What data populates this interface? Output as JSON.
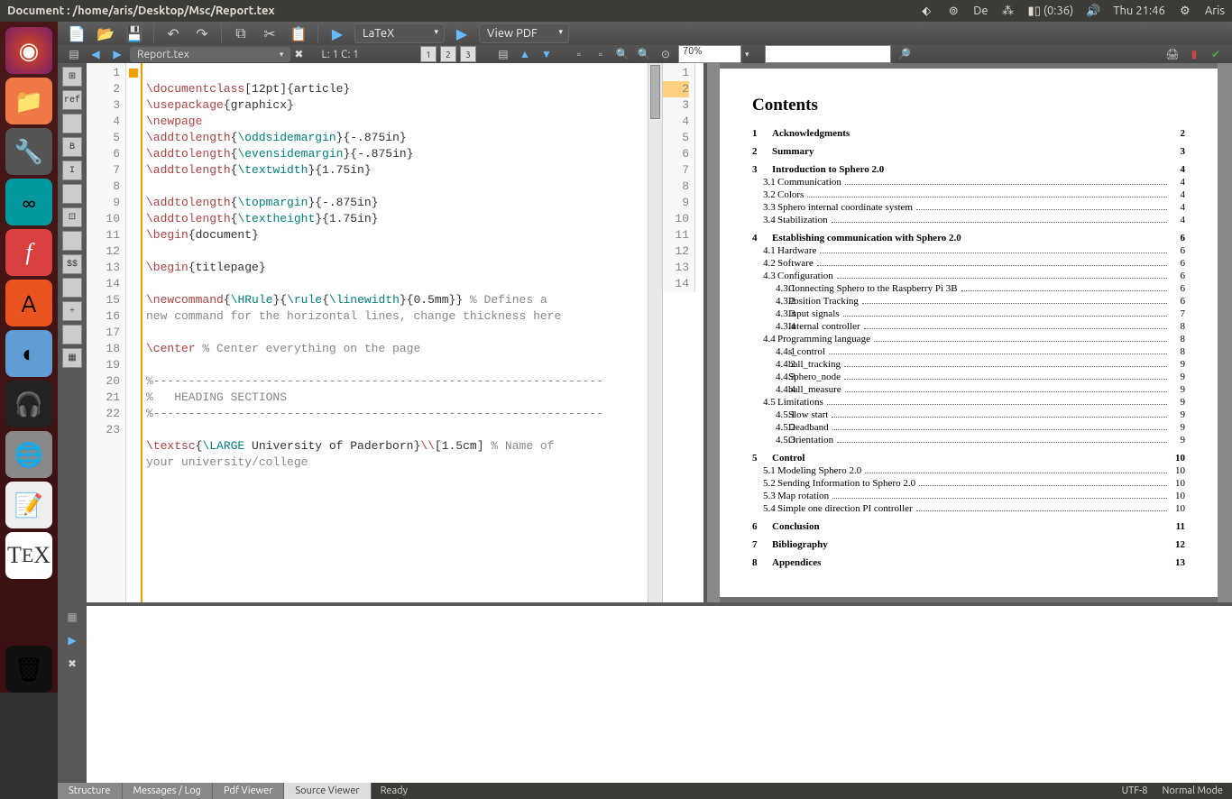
{
  "menubar": {
    "title": "Document : /home/aris/Desktop/Msc/Report.tex",
    "lang": "De",
    "battery": "(0:36)",
    "clock": "Thu 21:46",
    "user": "Aris"
  },
  "toolbar": {
    "latex_dropdown": "LaTeX",
    "view_dropdown": "View PDF"
  },
  "subtoolbar": {
    "tab_name": "Report.tex",
    "position": "L: 1 C: 1",
    "zoom": "70%"
  },
  "gutter_lines": [
    "1",
    "2",
    "3",
    "4",
    "5",
    "6",
    "7",
    "8",
    "9",
    "10",
    "11",
    "12",
    "13",
    "14",
    "15",
    "",
    "16",
    "17",
    "18",
    "19",
    "20",
    "21",
    "22",
    "23"
  ],
  "mini_gutter": [
    "1",
    "2",
    "3",
    "4",
    "5",
    "6",
    "7",
    "8",
    "9",
    "10",
    "11",
    "12",
    "13",
    "14"
  ],
  "code_lines": [
    {
      "raw": ""
    },
    {
      "parts": [
        {
          "t": "\\documentclass",
          "c": "kw"
        },
        {
          "t": "[12pt]{article}",
          "c": ""
        }
      ]
    },
    {
      "parts": [
        {
          "t": "\\usepackage",
          "c": "kw"
        },
        {
          "t": "{graphicx}",
          "c": ""
        }
      ]
    },
    {
      "parts": [
        {
          "t": "\\newpage",
          "c": "kw"
        }
      ]
    },
    {
      "parts": [
        {
          "t": "\\addtolength",
          "c": "kw"
        },
        {
          "t": "{",
          "c": ""
        },
        {
          "t": "\\oddsidemargin",
          "c": "cmd"
        },
        {
          "t": "}{-.875in}",
          "c": ""
        }
      ]
    },
    {
      "parts": [
        {
          "t": "\\addtolength",
          "c": "kw"
        },
        {
          "t": "{",
          "c": ""
        },
        {
          "t": "\\evensidemargin",
          "c": "cmd"
        },
        {
          "t": "}{-.875in}",
          "c": ""
        }
      ]
    },
    {
      "parts": [
        {
          "t": "\\addtolength",
          "c": "kw"
        },
        {
          "t": "{",
          "c": ""
        },
        {
          "t": "\\textwidth",
          "c": "cmd"
        },
        {
          "t": "}{1.75in}",
          "c": ""
        }
      ]
    },
    {
      "raw": ""
    },
    {
      "parts": [
        {
          "t": "\\addtolength",
          "c": "kw"
        },
        {
          "t": "{",
          "c": ""
        },
        {
          "t": "\\topmargin",
          "c": "cmd"
        },
        {
          "t": "}{-.875in}",
          "c": ""
        }
      ]
    },
    {
      "parts": [
        {
          "t": "\\addtolength",
          "c": "kw"
        },
        {
          "t": "{",
          "c": ""
        },
        {
          "t": "\\textheight",
          "c": "cmd"
        },
        {
          "t": "}{1.75in}",
          "c": ""
        }
      ]
    },
    {
      "parts": [
        {
          "t": "\\begin",
          "c": "kw"
        },
        {
          "t": "{document}",
          "c": ""
        }
      ]
    },
    {
      "raw": ""
    },
    {
      "parts": [
        {
          "t": "\\begin",
          "c": "kw"
        },
        {
          "t": "{titlepage}",
          "c": ""
        }
      ]
    },
    {
      "raw": ""
    },
    {
      "parts": [
        {
          "t": "\\newcommand",
          "c": "kw"
        },
        {
          "t": "{",
          "c": ""
        },
        {
          "t": "\\HRule",
          "c": "cmd"
        },
        {
          "t": "}{",
          "c": ""
        },
        {
          "t": "\\rule",
          "c": "cmd"
        },
        {
          "t": "{",
          "c": ""
        },
        {
          "t": "\\linewidth",
          "c": "cmd"
        },
        {
          "t": "}{0.5mm}} ",
          "c": ""
        },
        {
          "t": "% Defines a",
          "c": "comm"
        }
      ]
    },
    {
      "parts": [
        {
          "t": "new command for the horizontal lines, change thickness here",
          "c": "comm"
        }
      ]
    },
    {
      "raw": ""
    },
    {
      "parts": [
        {
          "t": "\\center",
          "c": "kw"
        },
        {
          "t": " ",
          "c": ""
        },
        {
          "t": "% Center everything on the page",
          "c": "comm"
        }
      ]
    },
    {
      "raw": ""
    },
    {
      "parts": [
        {
          "t": "%----------------------------------------------------------------",
          "c": "comm"
        }
      ]
    },
    {
      "parts": [
        {
          "t": "%   HEADING SECTIONS",
          "c": "comm"
        }
      ]
    },
    {
      "parts": [
        {
          "t": "%----------------------------------------------------------------",
          "c": "comm"
        }
      ]
    },
    {
      "raw": ""
    },
    {
      "parts": [
        {
          "t": "\\textsc",
          "c": "kw"
        },
        {
          "t": "{",
          "c": ""
        },
        {
          "t": "\\LARGE",
          "c": "cmd"
        },
        {
          "t": " University of Paderborn}",
          "c": ""
        },
        {
          "t": "\\\\",
          "c": "kw"
        },
        {
          "t": "[1.5cm] ",
          "c": ""
        },
        {
          "t": "% Name of",
          "c": "comm"
        }
      ]
    },
    {
      "parts": [
        {
          "t": "your university/college",
          "c": "comm"
        }
      ]
    }
  ],
  "palette": [
    "⊞",
    "ref",
    "",
    "B",
    "I",
    "",
    "⊡",
    "",
    "$$",
    "",
    "÷",
    "",
    "▦"
  ],
  "pdf": {
    "title": "Contents",
    "toc": [
      {
        "lvl": 0,
        "n": "1",
        "t": "Acknowledgments",
        "p": "2"
      },
      {
        "lvl": 0,
        "n": "2",
        "t": "Summary",
        "p": "3"
      },
      {
        "lvl": 0,
        "n": "3",
        "t": "Introduction to Sphero 2.0",
        "p": "4"
      },
      {
        "lvl": 1,
        "n": "3.1",
        "t": "Communication",
        "p": "4"
      },
      {
        "lvl": 1,
        "n": "3.2",
        "t": "Colors",
        "p": "4"
      },
      {
        "lvl": 1,
        "n": "3.3",
        "t": "Sphero internal coordinate system",
        "p": "4"
      },
      {
        "lvl": 1,
        "n": "3.4",
        "t": "Stabilization",
        "p": "4"
      },
      {
        "lvl": 0,
        "n": "4",
        "t": "Establishing communication with Sphero 2.0",
        "p": "6"
      },
      {
        "lvl": 1,
        "n": "4.1",
        "t": "Hardware",
        "p": "6"
      },
      {
        "lvl": 1,
        "n": "4.2",
        "t": "Software",
        "p": "6"
      },
      {
        "lvl": 1,
        "n": "4.3",
        "t": "Configuration",
        "p": "6"
      },
      {
        "lvl": 2,
        "n": "4.3.1",
        "t": "Connecting Sphero to the Raspberry Pi 3B",
        "p": "6"
      },
      {
        "lvl": 2,
        "n": "4.3.2",
        "t": "Position Tracking",
        "p": "6"
      },
      {
        "lvl": 2,
        "n": "4.3.3",
        "t": "Input signals",
        "p": "7"
      },
      {
        "lvl": 2,
        "n": "4.3.4",
        "t": "Internal controller",
        "p": "8"
      },
      {
        "lvl": 1,
        "n": "4.4",
        "t": "Programming language",
        "p": "8"
      },
      {
        "lvl": 2,
        "n": "4.4.1",
        "t": "s_control",
        "p": "8"
      },
      {
        "lvl": 2,
        "n": "4.4.2",
        "t": "ball_tracking",
        "p": "9"
      },
      {
        "lvl": 2,
        "n": "4.4.3",
        "t": "Sphero_node",
        "p": "9"
      },
      {
        "lvl": 2,
        "n": "4.4.4",
        "t": "ball_measure",
        "p": "9"
      },
      {
        "lvl": 1,
        "n": "4.5",
        "t": "Limitations",
        "p": "9"
      },
      {
        "lvl": 2,
        "n": "4.5.1",
        "t": "Slow start",
        "p": "9"
      },
      {
        "lvl": 2,
        "n": "4.5.2",
        "t": "Deadband",
        "p": "9"
      },
      {
        "lvl": 2,
        "n": "4.5.3",
        "t": "Orientation",
        "p": "9"
      },
      {
        "lvl": 0,
        "n": "5",
        "t": "Control",
        "p": "10"
      },
      {
        "lvl": 1,
        "n": "5.1",
        "t": "Modeling Sphero 2.0",
        "p": "10"
      },
      {
        "lvl": 1,
        "n": "5.2",
        "t": "Sending Information to Sphero 2.0",
        "p": "10"
      },
      {
        "lvl": 1,
        "n": "5.3",
        "t": "Map rotation",
        "p": "10"
      },
      {
        "lvl": 1,
        "n": "5.4",
        "t": "Simple one direction PI controller",
        "p": "10"
      },
      {
        "lvl": 0,
        "n": "6",
        "t": "Conclusion",
        "p": "11"
      },
      {
        "lvl": 0,
        "n": "7",
        "t": "Bibliography",
        "p": "12"
      },
      {
        "lvl": 0,
        "n": "8",
        "t": "Appendices",
        "p": "13"
      }
    ]
  },
  "statusbar": {
    "tabs": [
      "Structure",
      "Messages / Log",
      "Pdf Viewer",
      "Source Viewer"
    ],
    "msg": "Ready",
    "encoding": "UTF-8",
    "mode": "Normal Mode"
  }
}
